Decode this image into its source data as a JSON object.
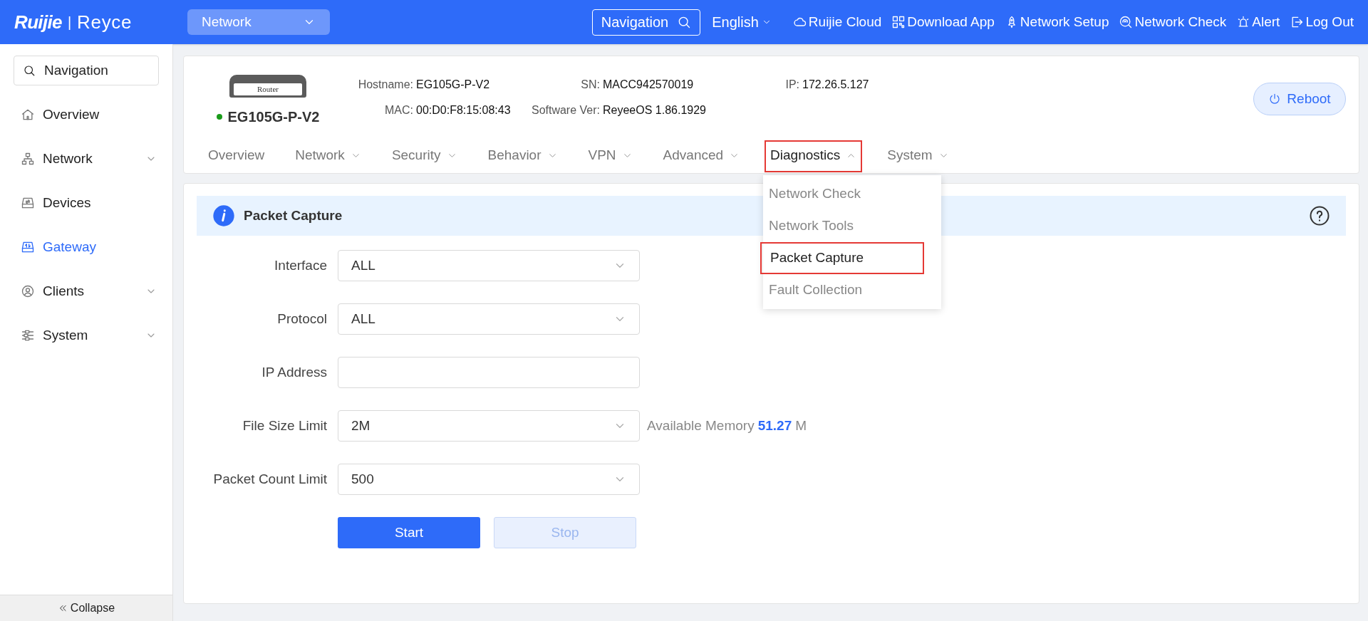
{
  "header": {
    "logo": "Ruijie",
    "logo_divider": "|",
    "brand": "Reyce",
    "network_select": "Network",
    "navigation_button": "Navigation",
    "language": "English",
    "links": [
      {
        "label": "Ruijie Cloud"
      },
      {
        "label": "Download App"
      },
      {
        "label": "Network Setup"
      },
      {
        "label": "Network Check"
      },
      {
        "label": "Alert"
      },
      {
        "label": "Log Out"
      }
    ]
  },
  "sidebar": {
    "search": "Navigation",
    "items": [
      {
        "label": "Overview",
        "selected": false,
        "expandable": false
      },
      {
        "label": "Network",
        "selected": false,
        "expandable": true
      },
      {
        "label": "Devices",
        "selected": false,
        "expandable": false
      },
      {
        "label": "Gateway",
        "selected": true,
        "expandable": false
      },
      {
        "label": "Clients",
        "selected": false,
        "expandable": true
      },
      {
        "label": "System",
        "selected": false,
        "expandable": true
      }
    ],
    "collapse": "Collapse"
  },
  "device": {
    "image_label": "Router",
    "name": "EG105G-P-V2",
    "online": true,
    "info": [
      {
        "label": "Hostname:",
        "value": "EG105G-P-V2"
      },
      {
        "label": "SN:",
        "value": "MACC942570019"
      },
      {
        "label": "IP:",
        "value": "172.26.5.127"
      },
      {
        "label": "MAC:",
        "value": "00:D0:F8:15:08:43"
      },
      {
        "label": "Software Ver:",
        "value": "ReyeeOS 1.86.1929"
      }
    ],
    "reboot": "Reboot"
  },
  "tabs": [
    {
      "label": "Overview",
      "selected": false,
      "dropdown": false,
      "highlighted": false
    },
    {
      "label": "Network",
      "selected": false,
      "dropdown": true,
      "highlighted": false
    },
    {
      "label": "Security",
      "selected": false,
      "dropdown": true,
      "highlighted": false
    },
    {
      "label": "Behavior",
      "selected": false,
      "dropdown": true,
      "highlighted": false
    },
    {
      "label": "VPN",
      "selected": false,
      "dropdown": true,
      "highlighted": false
    },
    {
      "label": "Advanced",
      "selected": false,
      "dropdown": true,
      "highlighted": false
    },
    {
      "label": "Diagnostics",
      "selected": true,
      "dropdown": true,
      "highlighted": true
    },
    {
      "label": "System",
      "selected": false,
      "dropdown": true,
      "highlighted": false
    }
  ],
  "menu": [
    {
      "label": "Network Check",
      "selected": false,
      "highlighted": false
    },
    {
      "label": "Network Tools",
      "selected": false,
      "highlighted": false
    },
    {
      "label": "Packet Capture",
      "selected": true,
      "highlighted": true
    },
    {
      "label": "Fault Collection",
      "selected": false,
      "highlighted": false
    }
  ],
  "panel": {
    "title": "Packet Capture",
    "fields": [
      {
        "label": "Interface",
        "kind": "select",
        "value": "ALL"
      },
      {
        "label": "Protocol",
        "kind": "select",
        "value": "ALL"
      },
      {
        "label": "IP Address",
        "kind": "text"
      },
      {
        "label": "File Size Limit",
        "kind": "select",
        "value": "2M",
        "note": {
          "label": "Available Memory",
          "value": "51.27",
          "unit": "M"
        }
      },
      {
        "label": "Packet Count Limit",
        "kind": "select",
        "value": "500"
      }
    ],
    "buttons": [
      {
        "label": "Start",
        "disabled": false
      },
      {
        "label": "Stop",
        "disabled": true
      }
    ]
  }
}
